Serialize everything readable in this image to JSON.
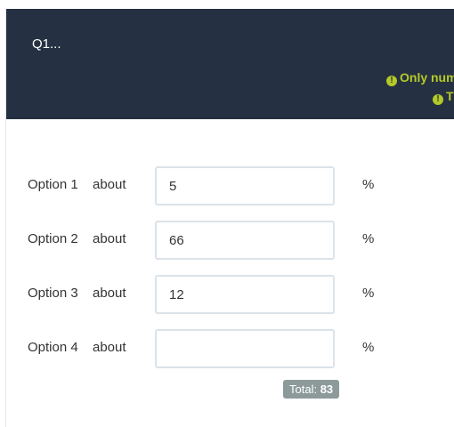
{
  "question": {
    "title": "Q1..."
  },
  "warnings": [
    {
      "icon": "exclamation-icon",
      "text": "Only num"
    },
    {
      "icon": "exclamation-icon",
      "text": "T"
    }
  ],
  "rows": [
    {
      "label": "Option 1",
      "qualifier": "about",
      "value": "5",
      "unit": "%"
    },
    {
      "label": "Option 2",
      "qualifier": "about",
      "value": "66",
      "unit": "%"
    },
    {
      "label": "Option 3",
      "qualifier": "about",
      "value": "12",
      "unit": "%"
    },
    {
      "label": "Option 4",
      "qualifier": "about",
      "value": "",
      "unit": "%"
    }
  ],
  "total": {
    "label": "Total:",
    "value": "83"
  },
  "colors": {
    "header_bg": "#253142",
    "warning": "#b5c928",
    "badge_bg": "#8c9a9a"
  }
}
